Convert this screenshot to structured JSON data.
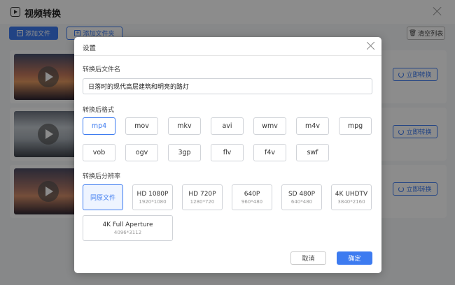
{
  "app": {
    "title": "视频转换",
    "add_file_label": "添加文件",
    "add_folder_label": "添加文件夹",
    "clear_list_label": "清空列表",
    "convert_label": "立即转换",
    "items": [
      {
        "thumb": "sunset-city"
      },
      {
        "thumb": "window-view"
      },
      {
        "thumb": "dusk-road"
      }
    ]
  },
  "dialog": {
    "title": "设置",
    "filename_label": "转换后文件名",
    "filename_value": "日落时的现代高层建筑和明亮的路灯",
    "format_label": "转换后格式",
    "formats": [
      "mp4",
      "mov",
      "mkv",
      "avi",
      "wmv",
      "m4v",
      "mpg",
      "vob",
      "ogv",
      "3gp",
      "flv",
      "f4v",
      "swf"
    ],
    "selected_format": "mp4",
    "resolution_label": "转换后分辨率",
    "resolutions": [
      {
        "name": "同原文件",
        "dim": ""
      },
      {
        "name": "HD 1080P",
        "dim": "1920*1080"
      },
      {
        "name": "HD 720P",
        "dim": "1280*720"
      },
      {
        "name": "640P",
        "dim": "960*480"
      },
      {
        "name": "SD 480P",
        "dim": "640*480"
      },
      {
        "name": "4K UHDTV",
        "dim": "3840*2160"
      },
      {
        "name": "4K Full Aperture",
        "dim": "4096*3112"
      }
    ],
    "selected_resolution": "同原文件",
    "cancel_label": "取消",
    "confirm_label": "确定"
  },
  "colors": {
    "accent": "#3d7bf0",
    "overlay": "rgba(0,0,0,0.45)"
  }
}
